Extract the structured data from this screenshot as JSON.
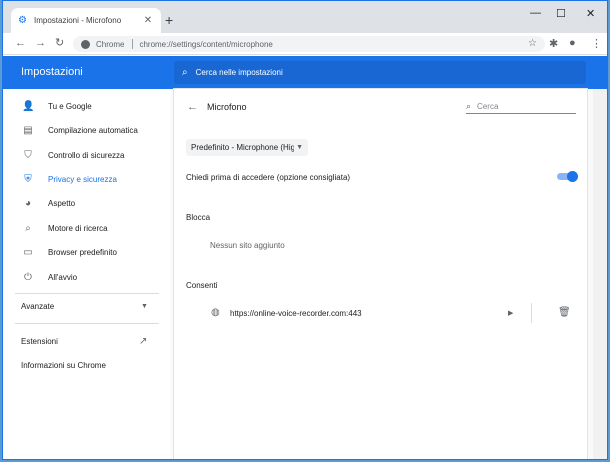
{
  "window": {
    "tab_title": "Impostazioni - Microfono",
    "tab_icon": "gear-icon",
    "new_tab_glyph": "+",
    "minimize_glyph": "—",
    "maximize_glyph": "☐",
    "close_glyph": "✕"
  },
  "toolbar": {
    "chip_label": "Chrome",
    "url": "chrome://settings/content/microphone"
  },
  "header": {
    "title": "Impostazioni",
    "search_placeholder": "Cerca nelle impostazioni"
  },
  "sidebar": {
    "items": [
      {
        "label": "Tu e Google",
        "icon": "person-icon"
      },
      {
        "label": "Compilazione automatica",
        "icon": "clipboard-icon"
      },
      {
        "label": "Controllo di sicurezza",
        "icon": "shield-check-icon"
      },
      {
        "label": "Privacy e sicurezza",
        "icon": "shield-icon"
      },
      {
        "label": "Aspetto",
        "icon": "palette-icon"
      },
      {
        "label": "Motore di ricerca",
        "icon": "search-icon"
      },
      {
        "label": "Browser predefinito",
        "icon": "browser-icon"
      },
      {
        "label": "All'avvio",
        "icon": "power-icon"
      }
    ],
    "advanced_label": "Avanzate",
    "extensions_label": "Estensioni",
    "about_label": "Informazioni su Chrome"
  },
  "content": {
    "page_title": "Microfono",
    "search_placeholder": "Cerca",
    "device_select": "Predefinito - Microphone (High",
    "ask_label": "Chiedi prima di accedere (opzione consigliata)",
    "ask_enabled": true,
    "block_header": "Blocca",
    "block_empty": "Nessun sito aggiunto",
    "allow_header": "Consenti",
    "allowed_sites": [
      {
        "url": "https://online-voice-recorder.com:443"
      }
    ]
  },
  "colors": {
    "accent": "#1a73e8",
    "header_search": "#1967d2",
    "toggle_track": "#8ab4f8"
  }
}
